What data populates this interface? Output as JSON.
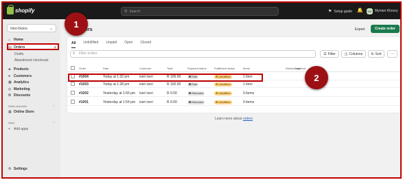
{
  "topbar": {
    "logo_text": "shopify",
    "search_placeholder": "Search",
    "setup_guide": "Setup guide",
    "avatar_initials": "MK",
    "user_name": "Myriam Khoury"
  },
  "sidebar": {
    "store_name": "iVeri-Demo",
    "items": [
      {
        "label": "Home"
      },
      {
        "label": "Orders",
        "badge": "4"
      },
      {
        "label": "Drafts"
      },
      {
        "label": "Abandoned checkouts"
      },
      {
        "label": "Products"
      },
      {
        "label": "Customers"
      },
      {
        "label": "Analytics"
      },
      {
        "label": "Marketing"
      },
      {
        "label": "Discounts"
      }
    ],
    "sales_channels_label": "Sales channels",
    "online_store": "Online Store",
    "apps_label": "Apps",
    "add_apps": "Add apps",
    "settings": "Settings"
  },
  "main": {
    "title": "Orders",
    "export": "Export",
    "create_order": "Create order",
    "tabs": [
      "All",
      "Unfulfilled",
      "Unpaid",
      "Open",
      "Closed"
    ],
    "filter_placeholder": "Filter orders",
    "filter_btn": "Filter",
    "columns_btn": "Columns",
    "sort_btn": "Sort",
    "more_btn": "···",
    "columns": [
      "Order",
      "Date",
      "Customer",
      "Total",
      "Payment status",
      "Fulfillment status",
      "Items",
      "Delivery method",
      "Tags"
    ],
    "rows": [
      {
        "order": "#1004",
        "date": "Today at 1:32 pm",
        "customer": "iveri iveri",
        "total": "R 100.00",
        "payment": "Paid",
        "fulfillment": "Unfulfilled",
        "items": "1 item"
      },
      {
        "order": "#1003",
        "date": "Today at 1:28 pm",
        "customer": "iveri iveri",
        "total": "R 100.00",
        "payment": "Paid",
        "fulfillment": "Unfulfilled",
        "items": "1 item"
      },
      {
        "order": "#1002",
        "date": "Yesterday at 1:56 pm",
        "customer": "iveri iveri",
        "total": "R 0.00",
        "payment": "Refunded",
        "fulfillment": "Unfulfilled",
        "items": "0 items"
      },
      {
        "order": "#1001",
        "date": "Yesterday at 1:54 pm",
        "customer": "iveri iveri",
        "total": "R 0.00",
        "payment": "Refunded",
        "fulfillment": "Unfulfilled",
        "items": "0 items"
      }
    ],
    "learn_prefix": "Learn more about",
    "learn_link": "orders"
  },
  "annotations": {
    "step1": "1",
    "step2": "2"
  }
}
